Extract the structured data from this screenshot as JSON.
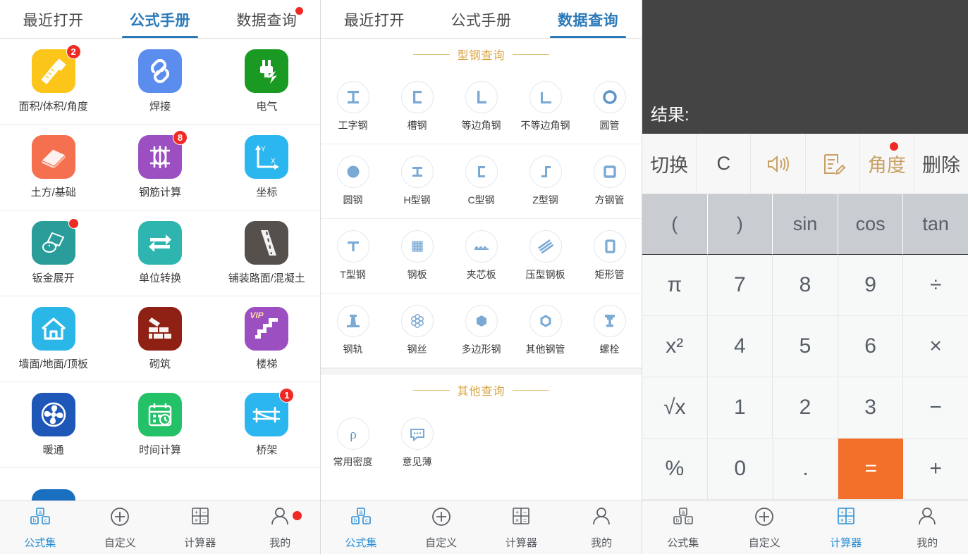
{
  "panel_a": {
    "tabs": [
      {
        "label": "最近打开",
        "active": false,
        "badge": false
      },
      {
        "label": "公式手册",
        "active": true,
        "badge": false
      },
      {
        "label": "数据查询",
        "active": false,
        "badge": true
      }
    ],
    "apps": [
      {
        "label": "面积/体积/角度",
        "icon": "ruler-pencil-icon",
        "color": "#fcc519",
        "badge": "2"
      },
      {
        "label": "焊接",
        "icon": "link-chain-icon",
        "color": "#5b8def",
        "badge": ""
      },
      {
        "label": "电气",
        "icon": "plug-lightning-icon",
        "color": "#1a9a22",
        "badge": ""
      },
      {
        "label": "土方/基础",
        "icon": "earthwork-icon",
        "color": "#f4704f",
        "badge": ""
      },
      {
        "label": "钢筋计算",
        "icon": "rebar-icon",
        "color": "#9b4fc0",
        "badge": "8"
      },
      {
        "label": "坐标",
        "icon": "axes-xy-icon",
        "color": "#2bb6ef",
        "badge": ""
      },
      {
        "label": "钣金展开",
        "icon": "sheet-metal-icon",
        "color": "#2a9d9a",
        "badge": "dot"
      },
      {
        "label": "单位转换",
        "icon": "swap-arrows-icon",
        "color": "#2fb5b0",
        "badge": ""
      },
      {
        "label": "铺装路面/混凝土",
        "icon": "road-icon",
        "color": "#55504c",
        "badge": ""
      },
      {
        "label": "墙面/地面/顶板",
        "icon": "house-icon",
        "color": "#2bb6e8",
        "badge": ""
      },
      {
        "label": "砌筑",
        "icon": "brick-wall-icon",
        "color": "#8e2014",
        "badge": ""
      },
      {
        "label": "楼梯",
        "icon": "stairs-icon",
        "color": "#9b4fc0",
        "badge": "",
        "vip": "VIP"
      },
      {
        "label": "暖通",
        "icon": "fan-icon",
        "color": "#1e57b8",
        "badge": ""
      },
      {
        "label": "时间计算",
        "icon": "calendar-clock-icon",
        "color": "#23c268",
        "badge": ""
      },
      {
        "label": "桥架",
        "icon": "cable-tray-icon",
        "color": "#2bb6ef",
        "badge": "1"
      },
      {
        "label": "",
        "icon": "house-yen-icon",
        "color": "#1b6fc0",
        "badge": ""
      }
    ],
    "nav": [
      {
        "label": "公式集",
        "icon": "abc-blocks-icon",
        "active": true,
        "badge": false
      },
      {
        "label": "自定义",
        "icon": "plus-circle-icon",
        "active": false,
        "badge": false
      },
      {
        "label": "计算器",
        "icon": "calculator-grid-icon",
        "active": false,
        "badge": false
      },
      {
        "label": "我的",
        "icon": "person-icon",
        "active": false,
        "badge": true
      }
    ]
  },
  "panel_b": {
    "tabs": [
      {
        "label": "最近打开",
        "active": false,
        "badge": false
      },
      {
        "label": "公式手册",
        "active": false,
        "badge": false
      },
      {
        "label": "数据查询",
        "active": true,
        "badge": false
      }
    ],
    "section1_title": "型钢查询",
    "section2_title": "其他查询",
    "steel_items": [
      {
        "label": "工字钢",
        "icon": "i-beam-icon"
      },
      {
        "label": "槽钢",
        "icon": "channel-steel-icon"
      },
      {
        "label": "等边角钢",
        "icon": "equal-angle-icon"
      },
      {
        "label": "不等边角钢",
        "icon": "unequal-angle-icon"
      },
      {
        "label": "圆管",
        "icon": "round-pipe-icon"
      },
      {
        "label": "圆钢",
        "icon": "round-bar-icon"
      },
      {
        "label": "H型钢",
        "icon": "h-beam-icon"
      },
      {
        "label": "C型钢",
        "icon": "c-channel-icon"
      },
      {
        "label": "Z型钢",
        "icon": "z-section-icon"
      },
      {
        "label": "方钢管",
        "icon": "square-tube-icon"
      },
      {
        "label": "T型钢",
        "icon": "t-section-icon"
      },
      {
        "label": "钢板",
        "icon": "steel-plate-icon"
      },
      {
        "label": "夹芯板",
        "icon": "sandwich-panel-icon"
      },
      {
        "label": "压型钢板",
        "icon": "profiled-sheet-icon"
      },
      {
        "label": "矩形管",
        "icon": "rect-tube-icon"
      },
      {
        "label": "钢轨",
        "icon": "rail-icon"
      },
      {
        "label": "钢丝",
        "icon": "steel-wire-icon"
      },
      {
        "label": "多边形钢",
        "icon": "polygon-bar-icon"
      },
      {
        "label": "其他钢管",
        "icon": "other-pipe-icon"
      },
      {
        "label": "螺栓",
        "icon": "bolt-icon"
      }
    ],
    "other_items": [
      {
        "label": "常用密度",
        "icon": "density-rho-icon"
      },
      {
        "label": "意见薄",
        "icon": "feedback-icon"
      }
    ],
    "nav": [
      {
        "label": "公式集",
        "icon": "abc-blocks-icon",
        "active": true,
        "badge": false
      },
      {
        "label": "自定义",
        "icon": "plus-circle-icon",
        "active": false,
        "badge": false
      },
      {
        "label": "计算器",
        "icon": "calculator-grid-icon",
        "active": false,
        "badge": false
      },
      {
        "label": "我的",
        "icon": "person-icon",
        "active": false,
        "badge": false
      }
    ]
  },
  "panel_c": {
    "display": {
      "result_label": "结果:",
      "expression": ""
    },
    "funcbar": [
      {
        "label": "切换",
        "icon": "",
        "gold": false,
        "badge": false
      },
      {
        "label": "C",
        "icon": "",
        "gold": false,
        "badge": false
      },
      {
        "label": "",
        "icon": "speaker-icon",
        "gold": true,
        "badge": false
      },
      {
        "label": "",
        "icon": "note-edit-icon",
        "gold": true,
        "badge": false
      },
      {
        "label": "角度",
        "icon": "",
        "gold": true,
        "badge": true
      },
      {
        "label": "删除",
        "icon": "",
        "gold": false,
        "badge": false
      }
    ],
    "keys_fnrow": [
      "(",
      ")",
      "sin",
      "cos",
      "tan"
    ],
    "keys_rows": [
      [
        "π",
        "7",
        "8",
        "9",
        "÷"
      ],
      [
        "x²",
        "4",
        "5",
        "6",
        "×"
      ],
      [
        "√x",
        "1",
        "2",
        "3",
        "−"
      ],
      [
        "%",
        "0",
        ".",
        "=",
        "+"
      ]
    ],
    "equals_key": "=",
    "accent_color": "#f2702a",
    "nav": [
      {
        "label": "公式集",
        "icon": "abc-blocks-icon",
        "active": false,
        "badge": false
      },
      {
        "label": "自定义",
        "icon": "plus-circle-icon",
        "active": false,
        "badge": false
      },
      {
        "label": "计算器",
        "icon": "calculator-grid-icon",
        "active": true,
        "badge": false
      },
      {
        "label": "我的",
        "icon": "person-icon",
        "active": false,
        "badge": false
      }
    ]
  }
}
